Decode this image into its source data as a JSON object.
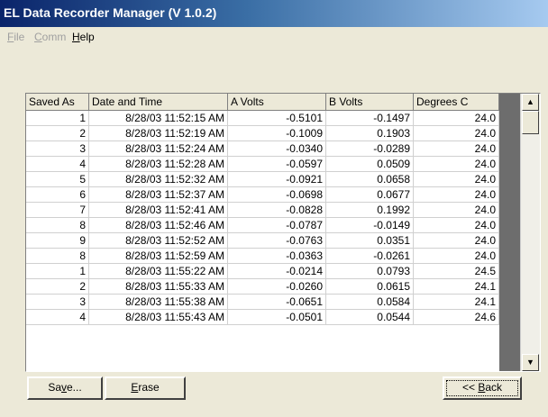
{
  "window": {
    "title": "EL Data Recorder Manager (V 1.0.2)"
  },
  "menu": [
    {
      "label": "File",
      "mnemonic": "F",
      "rest": "ile",
      "enabled": false
    },
    {
      "label": "Comm",
      "mnemonic": "C",
      "rest": "omm",
      "enabled": false
    },
    {
      "label": "Help",
      "mnemonic": "H",
      "rest": "elp",
      "enabled": true
    }
  ],
  "table": {
    "headers": [
      "Saved As",
      "Date and Time",
      "A Volts",
      "B Volts",
      "Degrees C"
    ],
    "rows": [
      [
        "1",
        "8/28/03 11:52:15 AM",
        "-0.5101",
        "-0.1497",
        "24.0"
      ],
      [
        "2",
        "8/28/03 11:52:19 AM",
        "-0.1009",
        "0.1903",
        "24.0"
      ],
      [
        "3",
        "8/28/03 11:52:24 AM",
        "-0.0340",
        "-0.0289",
        "24.0"
      ],
      [
        "4",
        "8/28/03 11:52:28 AM",
        "-0.0597",
        "0.0509",
        "24.0"
      ],
      [
        "5",
        "8/28/03 11:52:32 AM",
        "-0.0921",
        "0.0658",
        "24.0"
      ],
      [
        "6",
        "8/28/03 11:52:37 AM",
        "-0.0698",
        "0.0677",
        "24.0"
      ],
      [
        "7",
        "8/28/03 11:52:41 AM",
        "-0.0828",
        "0.1992",
        "24.0"
      ],
      [
        "8",
        "8/28/03 11:52:46 AM",
        "-0.0787",
        "-0.0149",
        "24.0"
      ],
      [
        "9",
        "8/28/03 11:52:52 AM",
        "-0.0763",
        "0.0351",
        "24.0"
      ],
      [
        "8",
        "8/28/03 11:52:59 AM",
        "-0.0363",
        "-0.0261",
        "24.0"
      ],
      [
        "1",
        "8/28/03 11:55:22 AM",
        "-0.0214",
        "0.0793",
        "24.5"
      ],
      [
        "2",
        "8/28/03 11:55:33 AM",
        "-0.0260",
        "0.0615",
        "24.1"
      ],
      [
        "3",
        "8/28/03 11:55:38 AM",
        "-0.0651",
        "0.0584",
        "24.1"
      ],
      [
        "4",
        "8/28/03 11:55:43 AM",
        "-0.0501",
        "0.0544",
        "24.6"
      ]
    ]
  },
  "scrollbar": {
    "up_icon": "triangle-up-icon",
    "down_icon": "triangle-down-icon"
  },
  "buttons": {
    "save": {
      "label": "Save...",
      "pre": "Sa",
      "mnemonic": "v",
      "post": "e..."
    },
    "erase": {
      "label": "Erase",
      "pre": "",
      "mnemonic": "E",
      "post": "rase"
    },
    "back": {
      "label": "<< Back",
      "pre": "<< ",
      "mnemonic": "B",
      "post": "ack"
    }
  }
}
